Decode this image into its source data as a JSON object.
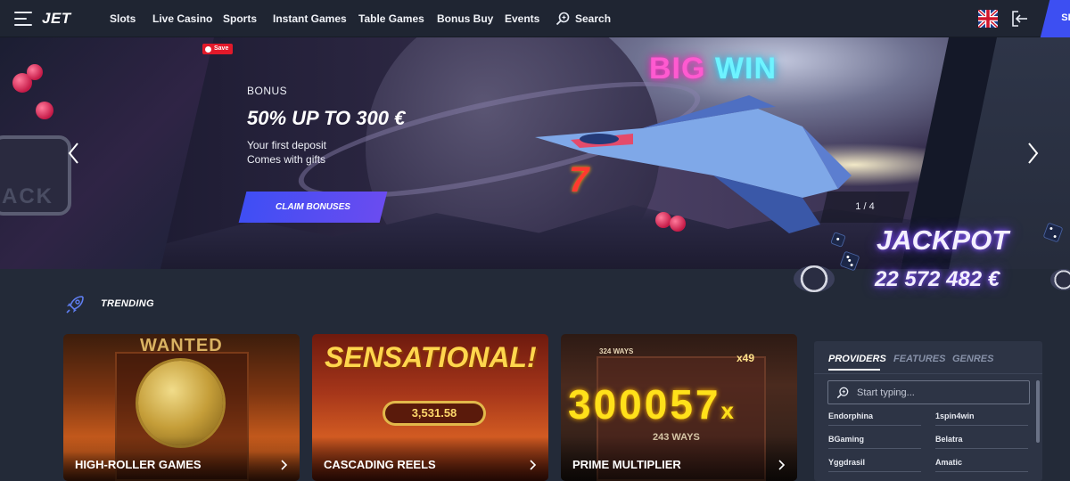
{
  "header": {
    "logo": "JET",
    "nav": [
      "Slots",
      "Live Casino",
      "Sports",
      "Instant Games",
      "Table Games",
      "Bonus Buy",
      "Events"
    ],
    "search_label": "Search",
    "signup_label": "SI"
  },
  "hero": {
    "save_label": "Save",
    "badge_text_left": "ACK",
    "neon_big": "BIG",
    "neon_win": "WIN",
    "seven": "7",
    "kicker": "BONUS",
    "title": "50% UP TO 300 €",
    "line1": "Your first deposit",
    "line2": "Comes with gifts",
    "cta": "CLAIM BONUSES",
    "slide_counter": "1 / 4"
  },
  "jackpot": {
    "title": "JACKPOT",
    "amount": "22 572 482 €"
  },
  "trending": {
    "label": "TRENDING",
    "tiles": [
      {
        "label": "HIGH-ROLLER GAMES",
        "art_text": "WANTED"
      },
      {
        "label": "CASCADING REELS",
        "art_text": "SENSATIONAL!",
        "art_value": "3,531.58"
      },
      {
        "label": "PRIME MULTIPLIER",
        "art_text": "300057",
        "art_suffix": "x",
        "art_ways": "243 WAYS",
        "art_x": "x49",
        "art_top": "324 WAYS"
      }
    ]
  },
  "filters": {
    "tabs": [
      "PROVIDERS",
      "FEATURES",
      "GENRES"
    ],
    "active_tab": "PROVIDERS",
    "search_placeholder": "Start typing...",
    "providers": [
      "Endorphina",
      "1spin4win",
      "BGaming",
      "Belatra",
      "Yggdrasil",
      "Amatic"
    ]
  },
  "colors": {
    "background": "#232a38",
    "topbar": "#1f2532",
    "accent": "#3d4ff2",
    "jackpot_glow": "#8a5cff"
  },
  "icons": [
    "menu-icon",
    "search-icon",
    "uk-flag-icon",
    "login-icon",
    "chevron-left-icon",
    "chevron-right-icon",
    "rocket-icon"
  ]
}
